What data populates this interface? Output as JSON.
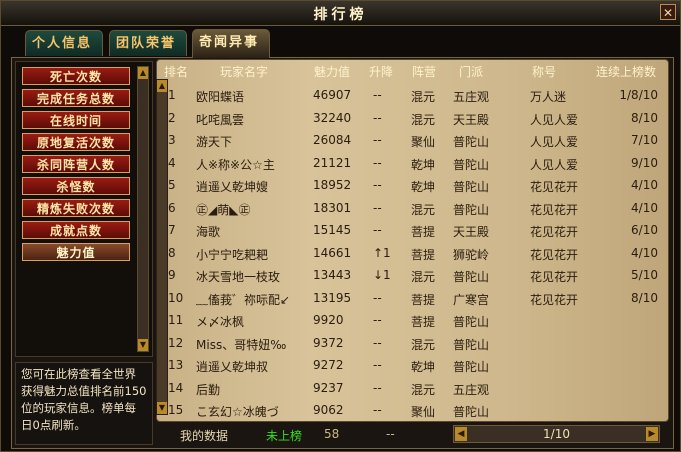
{
  "window": {
    "title": "排行榜",
    "close_label": "✕"
  },
  "tabs": [
    {
      "label": "个人信息",
      "active": false
    },
    {
      "label": "团队荣誉",
      "active": false
    },
    {
      "label": "奇闻异事",
      "active": true
    }
  ],
  "categories": [
    {
      "label": "死亡次数",
      "active": false
    },
    {
      "label": "完成任务总数",
      "active": false
    },
    {
      "label": "在线时间",
      "active": false
    },
    {
      "label": "原地复活次数",
      "active": false
    },
    {
      "label": "杀同阵营人数",
      "active": false
    },
    {
      "label": "杀怪数",
      "active": false
    },
    {
      "label": "精炼失败次数",
      "active": false
    },
    {
      "label": "成就点数",
      "active": false
    },
    {
      "label": "魅力值",
      "active": true
    }
  ],
  "hint": "您可在此榜查看全世界获得魅力总值排名前150位的玩家信息。榜单每日0点刷新。",
  "table": {
    "headers": {
      "rank": "排名",
      "name": "玩家名字",
      "value": "魅力值",
      "change": "升降",
      "camp": "阵营",
      "sect": "门派",
      "title": "称号",
      "weeks": "连续上榜数"
    },
    "rows": [
      {
        "rank": "1",
        "name": "欧阳蝶语",
        "value": "46907",
        "change": "--",
        "camp": "混元",
        "sect": "五庄观",
        "title": "万人迷",
        "weeks": "1/8/10"
      },
      {
        "rank": "2",
        "name": "叱咤風雲",
        "value": "32240",
        "change": "--",
        "camp": "混元",
        "sect": "天王殿",
        "title": "人见人爱",
        "weeks": "8/10"
      },
      {
        "rank": "3",
        "name": "游天下",
        "value": "26084",
        "change": "--",
        "camp": "聚仙",
        "sect": "普陀山",
        "title": "人见人爱",
        "weeks": "7/10"
      },
      {
        "rank": "4",
        "name": "人※称※公☆主",
        "value": "21121",
        "change": "--",
        "camp": "乾坤",
        "sect": "普陀山",
        "title": "人见人爱",
        "weeks": "9/10"
      },
      {
        "rank": "5",
        "name": "逍遥乂乾坤嫂",
        "value": "18952",
        "change": "--",
        "camp": "乾坤",
        "sect": "普陀山",
        "title": "花见花开",
        "weeks": "4/10"
      },
      {
        "rank": "6",
        "name": "㊣◢萌◣㊣",
        "value": "18301",
        "change": "--",
        "camp": "混元",
        "sect": "普陀山",
        "title": "花见花开",
        "weeks": "4/10"
      },
      {
        "rank": "7",
        "name": "海歌",
        "value": "15145",
        "change": "--",
        "camp": "菩提",
        "sect": "天王殿",
        "title": "花见花开",
        "weeks": "6/10"
      },
      {
        "rank": "8",
        "name": "小宁宁吃耙耙",
        "value": "14661",
        "change": "↑1",
        "camp": "菩提",
        "sect": "狮驼岭",
        "title": "花见花开",
        "weeks": "4/10"
      },
      {
        "rank": "9",
        "name": "冰天雪地一枝玫",
        "value": "13443",
        "change": "↓1",
        "camp": "混元",
        "sect": "普陀山",
        "title": "花见花开",
        "weeks": "5/10"
      },
      {
        "rank": "10",
        "name": "﹏傗莪゛祢呩配↙",
        "value": "13195",
        "change": "--",
        "camp": "菩提",
        "sect": "广寒宫",
        "title": "花见花开",
        "weeks": "8/10"
      },
      {
        "rank": "11",
        "name": "メ〆冰枫",
        "value": "9920",
        "change": "--",
        "camp": "菩提",
        "sect": "普陀山",
        "title": "",
        "weeks": ""
      },
      {
        "rank": "12",
        "name": "Miss、哥特妞‰",
        "value": "9372",
        "change": "--",
        "camp": "混元",
        "sect": "普陀山",
        "title": "",
        "weeks": ""
      },
      {
        "rank": "13",
        "name": "逍遥乂乾坤叔",
        "value": "9272",
        "change": "--",
        "camp": "乾坤",
        "sect": "普陀山",
        "title": "",
        "weeks": ""
      },
      {
        "rank": "14",
        "name": "后勤",
        "value": "9237",
        "change": "--",
        "camp": "混元",
        "sect": "五庄观",
        "title": "",
        "weeks": ""
      },
      {
        "rank": "15",
        "name": "こ玄幻☆冰魄づ",
        "value": "9062",
        "change": "--",
        "camp": "聚仙",
        "sect": "普陀山",
        "title": "",
        "weeks": ""
      }
    ]
  },
  "footer": {
    "label": "我的数据",
    "status": "未上榜",
    "value": "58",
    "change": "--",
    "page": "1/10"
  },
  "colors": {
    "accent_red": "#9a1c12",
    "status_green": "#34e11a",
    "parchment": "#d8c39a"
  }
}
